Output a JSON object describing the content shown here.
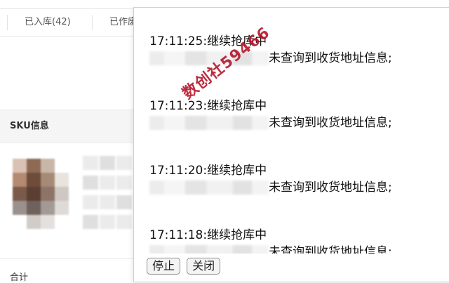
{
  "tabs": [
    {
      "label": "已入库(42)"
    },
    {
      "label": "已作废"
    }
  ],
  "sku_section": {
    "header": "SKU信息"
  },
  "summary": {
    "total_label": "合计"
  },
  "log_dialog": {
    "entries": [
      {
        "time_line": "17:11:25:继续抢库中",
        "message": "未查询到收货地址信息;"
      },
      {
        "time_line": "17:11:23:继续抢库中",
        "message": "未查询到收货地址信息;"
      },
      {
        "time_line": "17:11:20:继续抢库中",
        "message": "未查询到收货地址信息;"
      },
      {
        "time_line": "17:11:18:继续抢库中",
        "message": "未查询到收货地址信息;"
      }
    ],
    "buttons": {
      "stop": "停止",
      "close": "关闭"
    }
  },
  "watermark": {
    "text": "数创社59466",
    "color": "#b5162a"
  }
}
